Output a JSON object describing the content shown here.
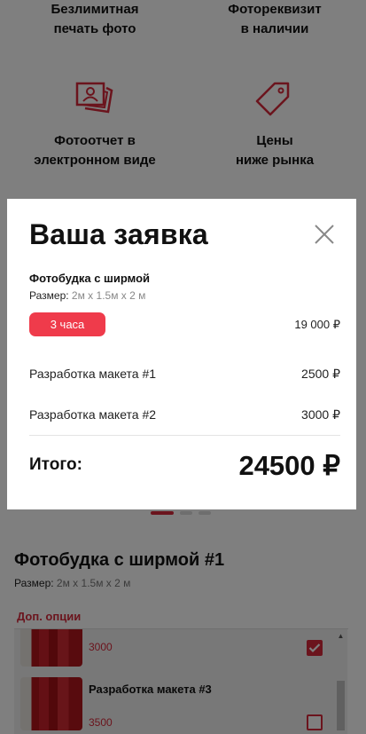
{
  "features": [
    {
      "line1": "Безлимитная",
      "line2": "печать фото",
      "icon": "infinite-print-icon"
    },
    {
      "line1": "Фотореквизит",
      "line2": "в наличии",
      "icon": "props-icon"
    },
    {
      "line1": "Фотоотчет в",
      "line2": "электронном виде",
      "icon": "photo-report-icon"
    },
    {
      "line1": "Цены",
      "line2": "ниже рынка",
      "icon": "price-tag-icon"
    }
  ],
  "product": {
    "title": "Фотобудка с ширмой #1",
    "size_label": "Размер:",
    "size_value": "2м х 1.5м х 2 м",
    "options_tab": "Доп. опции",
    "options": [
      {
        "name": "",
        "price": "3000",
        "checked": true
      },
      {
        "name": "Разработка макета #3",
        "price": "3500",
        "checked": false
      }
    ]
  },
  "modal": {
    "title": "Ваша заявка",
    "product_name": "Фотобудка с ширмой",
    "size_label": "Размер:",
    "size_value": "2м х 1.5м х 2 м",
    "duration": "3 часа",
    "duration_price": "19 000 ₽",
    "lines": [
      {
        "label": "Разработка макета #1",
        "price": "2500 ₽"
      },
      {
        "label": "Разработка макета #2",
        "price": "3000 ₽"
      }
    ],
    "total_label": "Итого:",
    "total_value": "24500 ₽"
  },
  "colors": {
    "accent": "#d6293a",
    "badge": "#ef3b4b",
    "overlay": "rgba(0,0,0,0.5)"
  }
}
